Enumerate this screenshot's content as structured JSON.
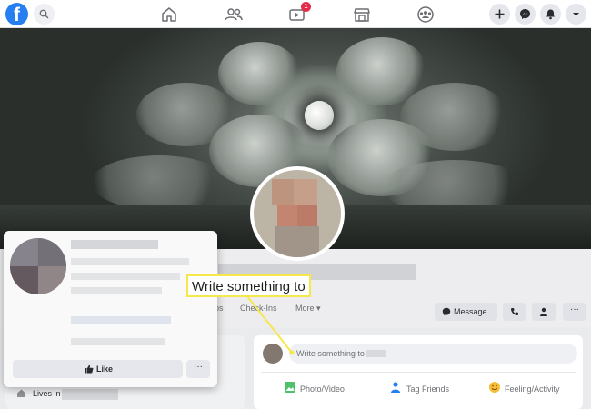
{
  "topbar": {
    "logo": "f",
    "icons": [
      "search-icon",
      "home-icon",
      "friends-icon",
      "watch-icon",
      "marketplace-icon",
      "groups-icon",
      "plus-icon",
      "messenger-icon",
      "notifications-icon",
      "dropdown-icon"
    ],
    "watch_badge": "1"
  },
  "profile": {
    "tabs": [
      "os",
      "Check-Ins",
      "More"
    ],
    "message_label": "Message"
  },
  "hover_card": {
    "like_label": "Like",
    "more_label": "···"
  },
  "intro": {
    "lives_in_label": "Lives in"
  },
  "composer": {
    "placeholder": "Write something to",
    "photo_label": "Photo/Video",
    "tag_label": "Tag Friends",
    "feeling_label": "Feeling/Activity"
  },
  "callout": {
    "text": "Write something to"
  },
  "colors": {
    "brand": "#1877f2",
    "callout_border": "#f6e84b",
    "badge": "#e41e3f"
  }
}
